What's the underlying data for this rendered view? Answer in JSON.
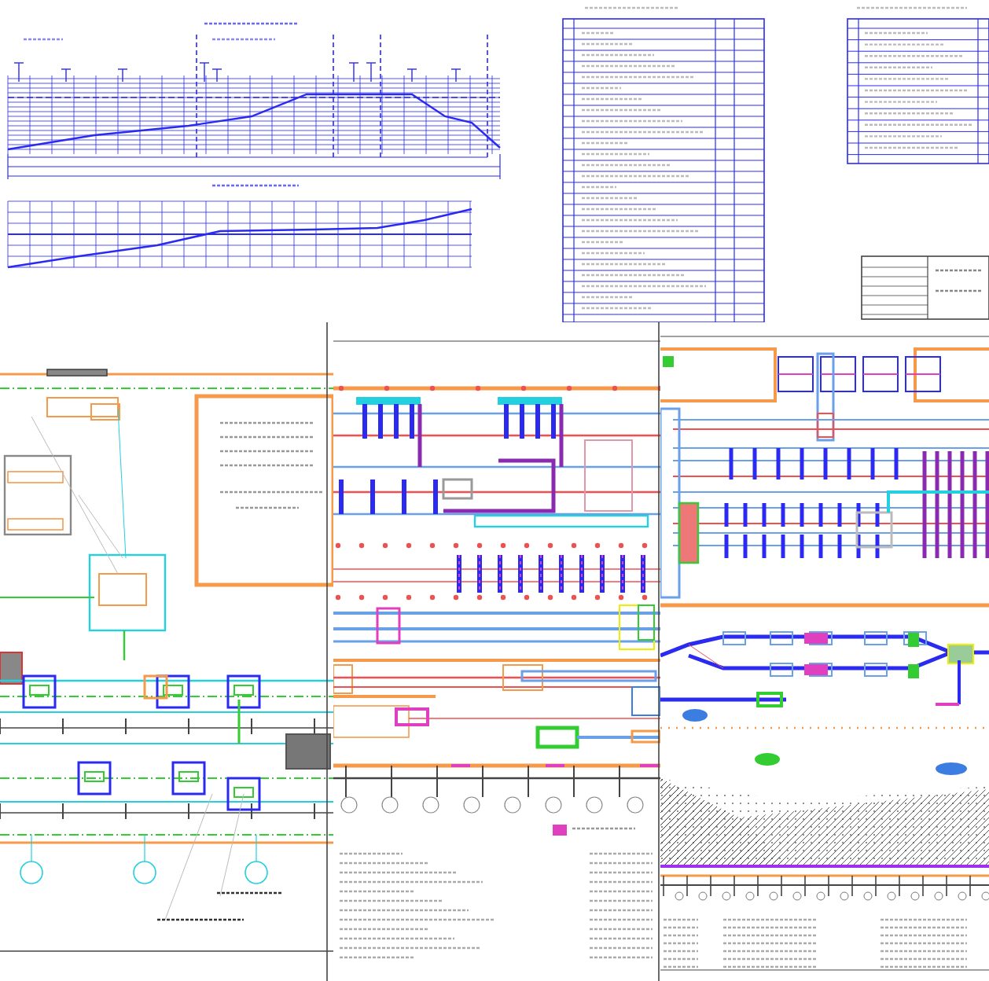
{
  "sheets": [
    {
      "kind": "profile_tables"
    },
    {
      "kind": "plan_left"
    },
    {
      "kind": "plan_middle"
    },
    {
      "kind": "plan_right"
    }
  ]
}
